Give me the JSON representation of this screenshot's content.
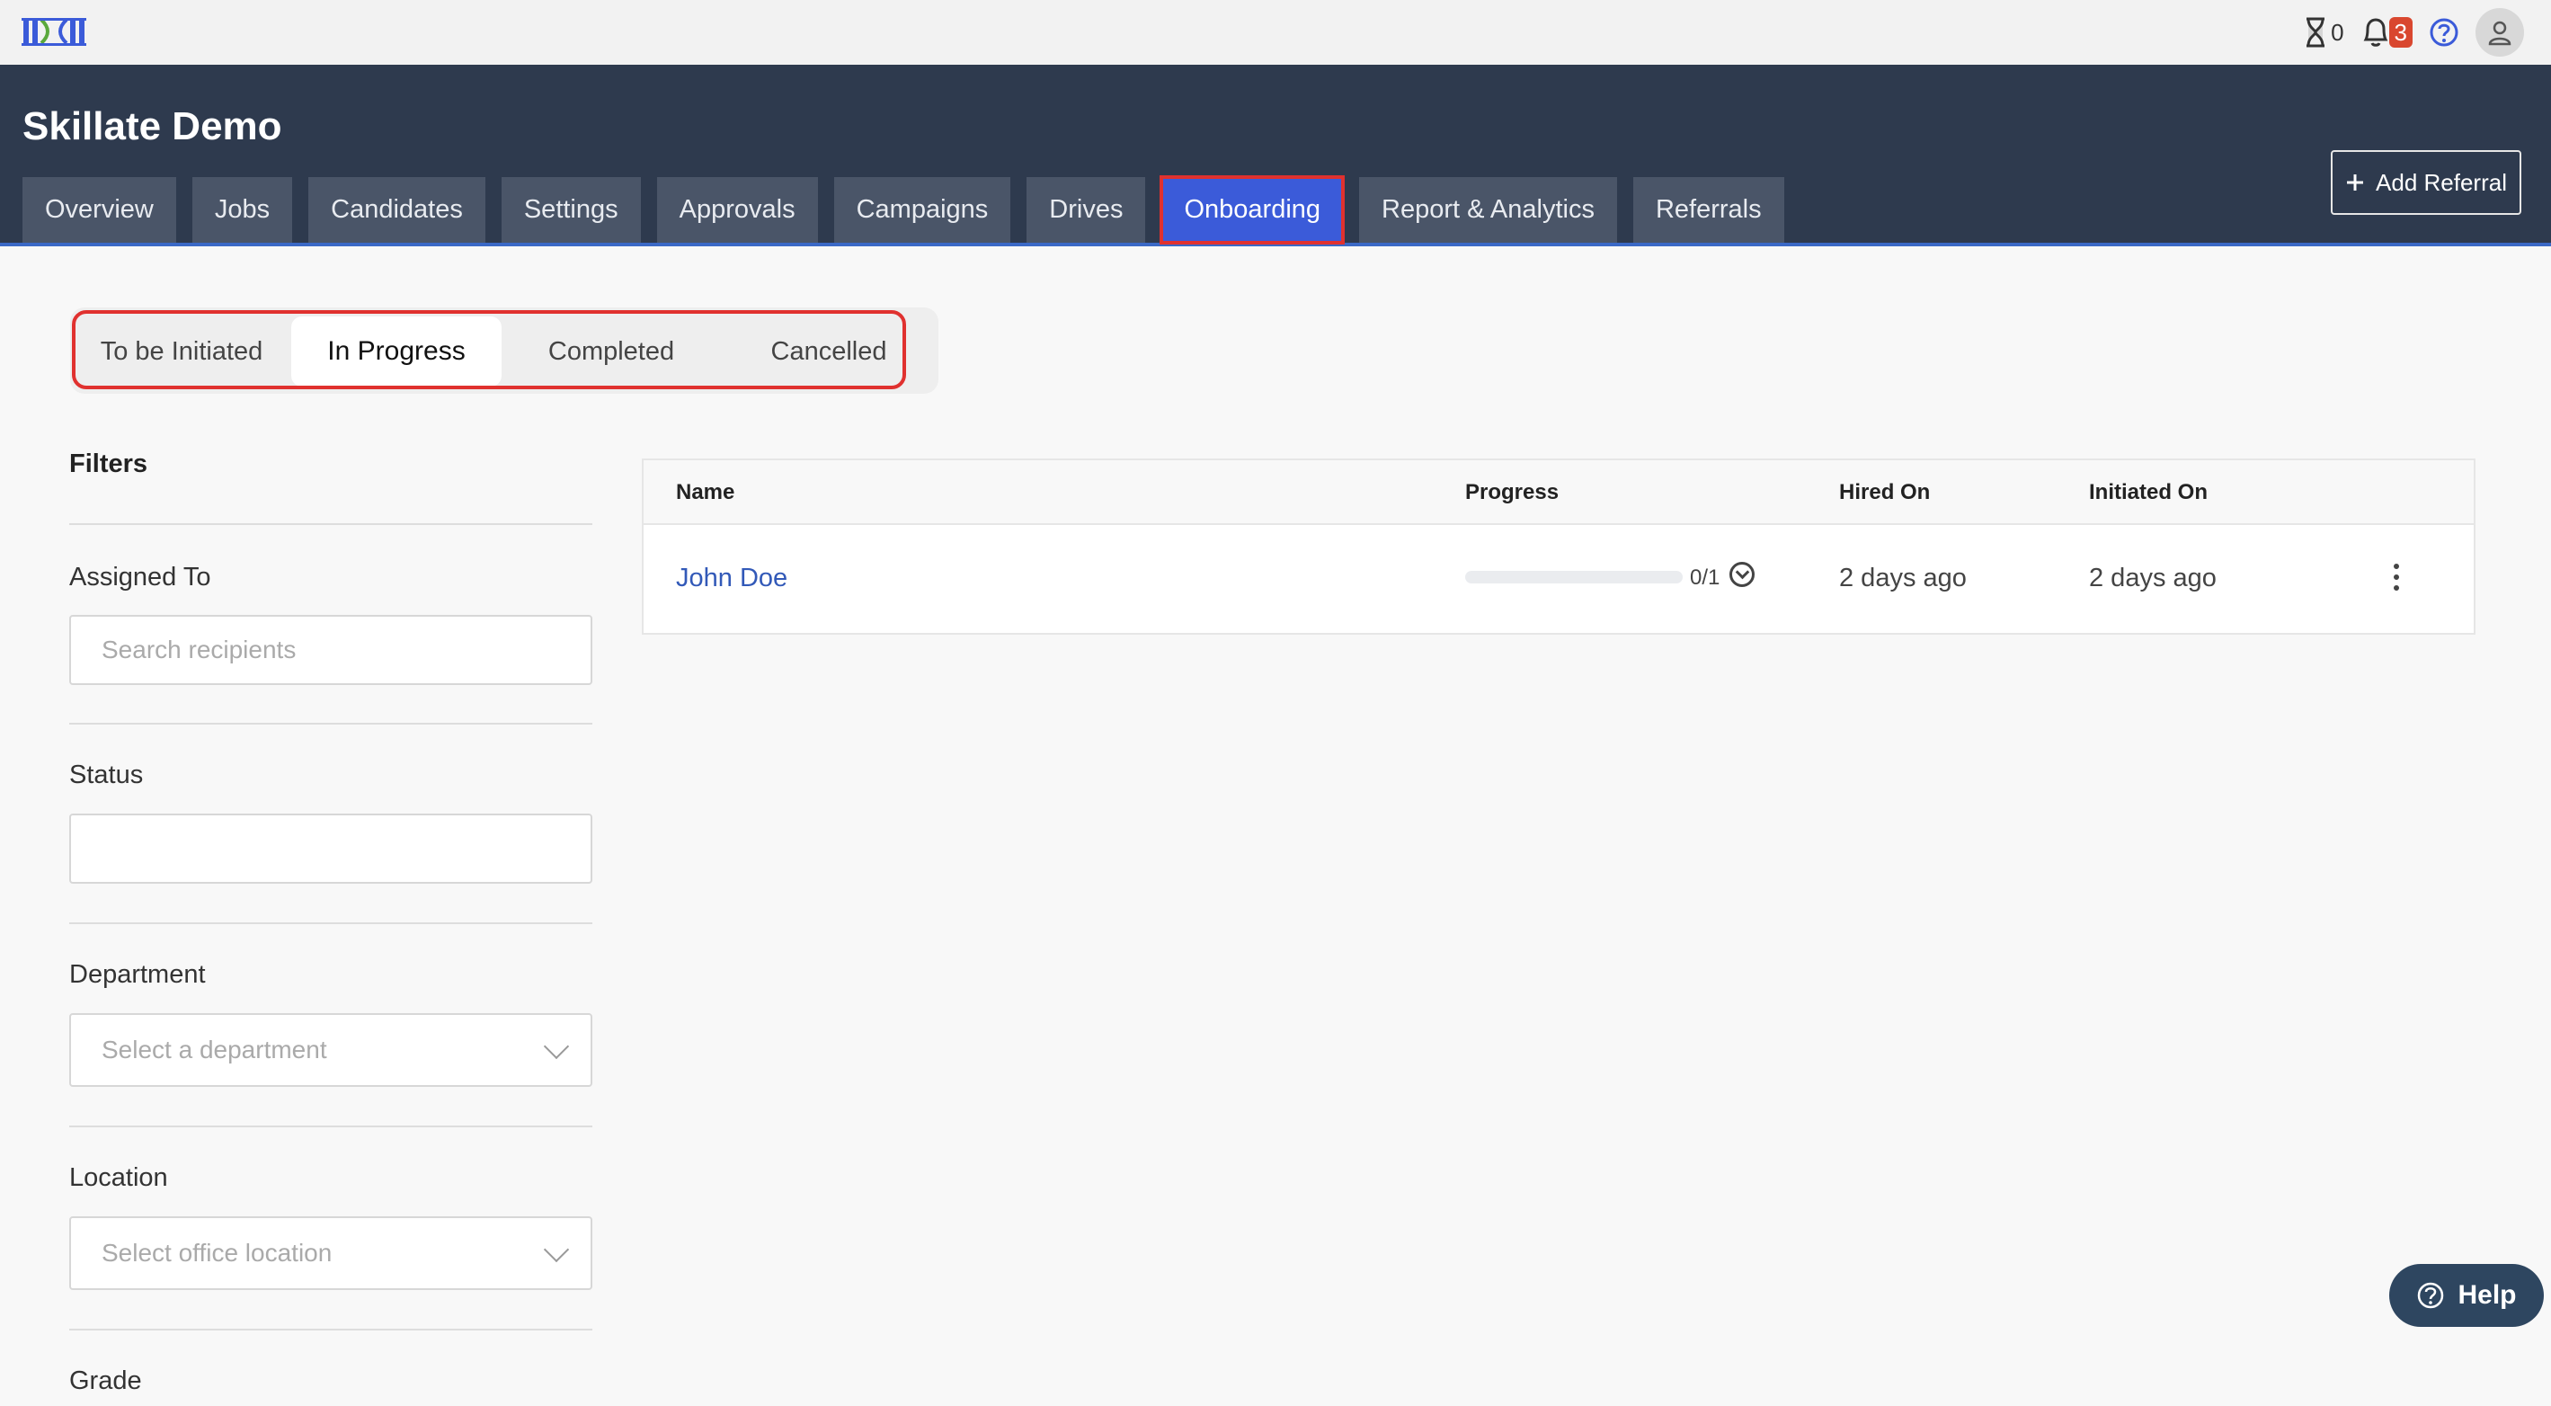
{
  "topbar": {
    "hourglass_count": "0",
    "notifications_count": "3"
  },
  "header": {
    "company_name": "Skillate Demo",
    "add_referral_label": "Add Referral",
    "tabs": [
      {
        "label": "Overview"
      },
      {
        "label": "Jobs"
      },
      {
        "label": "Candidates"
      },
      {
        "label": "Settings"
      },
      {
        "label": "Approvals"
      },
      {
        "label": "Campaigns"
      },
      {
        "label": "Drives"
      },
      {
        "label": "Onboarding"
      },
      {
        "label": "Report & Analytics"
      },
      {
        "label": "Referrals"
      }
    ],
    "active_tab": "Onboarding"
  },
  "segments": {
    "items": [
      {
        "label": "To be Initiated"
      },
      {
        "label": "In Progress"
      },
      {
        "label": "Completed"
      },
      {
        "label": "Cancelled"
      }
    ],
    "active": "In Progress"
  },
  "filters": {
    "title": "Filters",
    "assigned_to": {
      "label": "Assigned To",
      "placeholder": "Search recipients"
    },
    "status": {
      "label": "Status",
      "value": ""
    },
    "department": {
      "label": "Department",
      "placeholder": "Select a department"
    },
    "location": {
      "label": "Location",
      "placeholder": "Select office location"
    },
    "grade": {
      "label": "Grade"
    }
  },
  "table": {
    "columns": [
      "Name",
      "Progress",
      "Hired On",
      "Initiated On"
    ],
    "rows": [
      {
        "name": "John Doe",
        "progress_text": "0/1",
        "progress_fraction": 0,
        "hired_on": "2 days ago",
        "initiated_on": "2 days ago"
      }
    ]
  },
  "help_button": {
    "label": "Help"
  },
  "colors": {
    "header_bg": "#2e3a4e",
    "active_tab": "#3b5bd9",
    "highlight_outline": "#e0312f",
    "link": "#3259b8",
    "badge": "#d9472f",
    "help_bg": "#2e4660"
  }
}
